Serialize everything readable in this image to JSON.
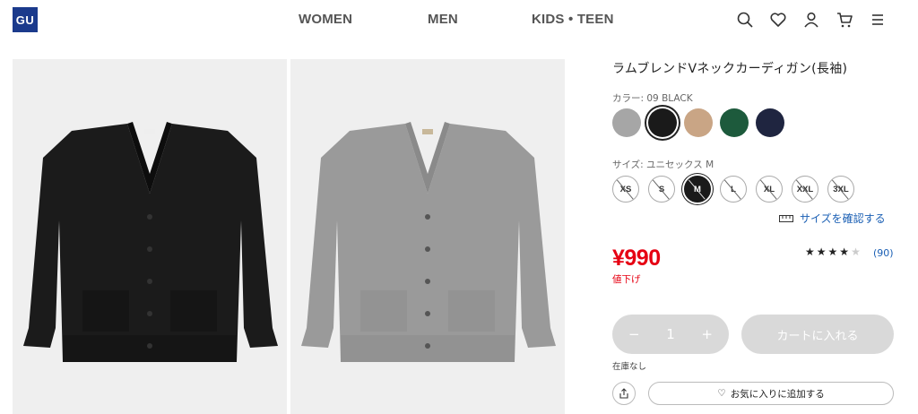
{
  "header": {
    "logo": "GU",
    "nav": [
      "WOMEN",
      "MEN",
      "KIDS • TEEN"
    ],
    "icons": [
      "search-icon",
      "heart-icon",
      "user-icon",
      "cart-icon",
      "menu-icon"
    ]
  },
  "product": {
    "title": "ラムブレンドVネックカーディガン(長袖)",
    "color_label": "カラー: 09 BLACK",
    "colors": [
      {
        "name": "gray",
        "hex": "#a6a6a6"
      },
      {
        "name": "black",
        "hex": "#1a1a1a"
      },
      {
        "name": "beige",
        "hex": "#c9a585"
      },
      {
        "name": "green",
        "hex": "#1d5a3c"
      },
      {
        "name": "navy",
        "hex": "#1f2540"
      }
    ],
    "selected_color": "black",
    "size_label": "サイズ: ユニセックス M",
    "sizes": [
      "XS",
      "S",
      "M",
      "L",
      "XL",
      "XXL",
      "3XL"
    ],
    "selected_size": "M",
    "size_link": "サイズを確認する",
    "price": "¥990",
    "price_note": "値下げ",
    "rating_stars": 4,
    "review_count": "(90)",
    "quantity": {
      "minus": "−",
      "value": "1",
      "plus": "+"
    },
    "cart_button": "カートに入れる",
    "stock": "在庫なし",
    "favorite_button": "お気に入りに追加する"
  },
  "colors": {
    "accent_red": "#e60012",
    "link_blue": "#1a5fb4",
    "disabled_gray": "#d9d9d9",
    "logo_blue": "#1b3a8c"
  }
}
